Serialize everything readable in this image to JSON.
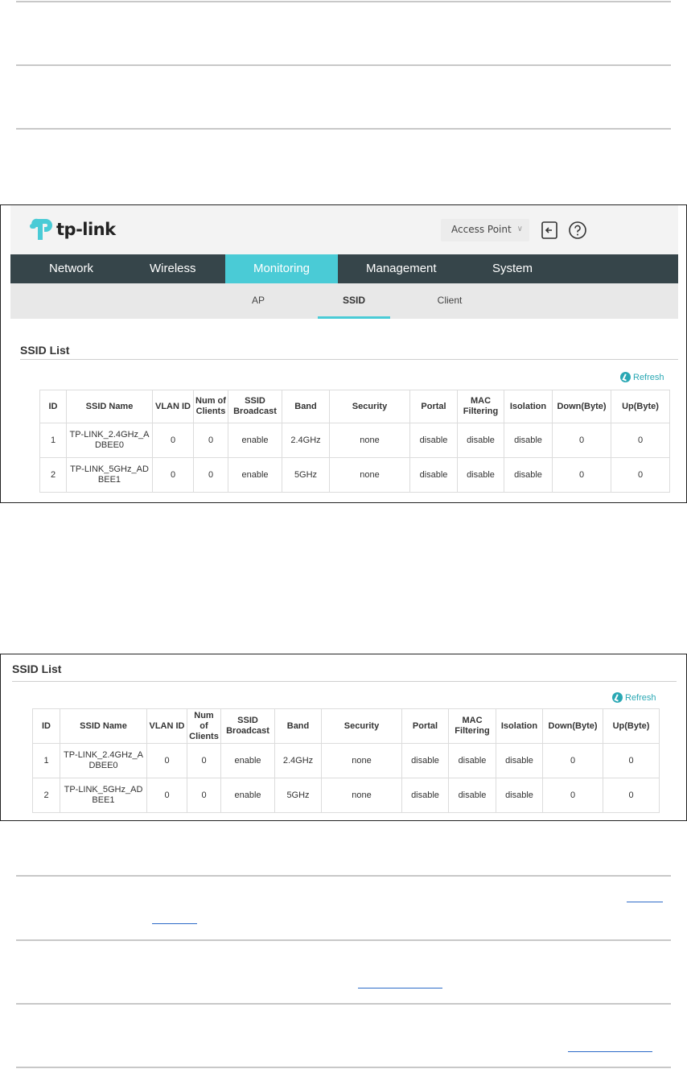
{
  "header": {
    "logo_text": "tp-link",
    "mode_select": "Access Point",
    "icons": [
      "logout-icon",
      "help-icon"
    ]
  },
  "main_nav": [
    {
      "label": "Network"
    },
    {
      "label": "Wireless"
    },
    {
      "label": "Monitoring"
    },
    {
      "label": "Management"
    },
    {
      "label": "System"
    }
  ],
  "sub_nav": [
    {
      "label": "AP"
    },
    {
      "label": "SSID"
    },
    {
      "label": "Client"
    }
  ],
  "ssid_list": {
    "title": "SSID List",
    "refresh": "Refresh",
    "columns": [
      "ID",
      "SSID Name",
      "VLAN ID",
      "Num of Clients",
      "SSID Broadcast",
      "Band",
      "Security",
      "Portal",
      "MAC Filtering",
      "Isolation",
      "Down(Byte)",
      "Up(Byte)"
    ],
    "rows": [
      [
        "1",
        "TP-LINK_2.4GHz_ADBEE0",
        "0",
        "0",
        "enable",
        "2.4GHz",
        "none",
        "disable",
        "disable",
        "disable",
        "0",
        "0"
      ],
      [
        "2",
        "TP-LINK_5GHz_ADBEE1",
        "0",
        "0",
        "enable",
        "5GHz",
        "none",
        "disable",
        "disable",
        "disable",
        "0",
        "0"
      ]
    ]
  },
  "colors": {
    "nav_bg": "#36454a",
    "accent": "#4acbd6",
    "refresh": "#2aa8b4"
  }
}
